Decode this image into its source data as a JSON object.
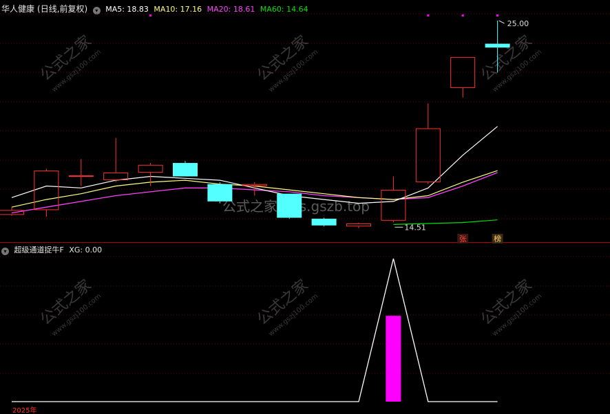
{
  "stock": {
    "name": "华人健康",
    "period": "(日线,前复权)",
    "ma5_label": "MA5: 18.83",
    "ma10_label": "MA10: 17.16",
    "ma20_label": "MA20: 18.61",
    "ma60_label": "MA60: 14.64"
  },
  "indicator": {
    "name": "超级通道捉牛F",
    "xg_label": "XG: 0.00"
  },
  "annotations": {
    "high": "25.00",
    "low": "14.51",
    "tag_zhang": "张",
    "tag_bang": "榜",
    "year": "2025年"
  },
  "watermark": {
    "logo_text": "公式之家",
    "url_small": "www.gszj100.com",
    "url_center": "公式之家 bbs.gszb.top"
  },
  "colors": {
    "background": "#000000",
    "up_candle": "#ff3232",
    "down_candle": "#54ffff",
    "ma5": "#ffffff",
    "ma10": "#ffff80",
    "ma20": "#ff40ff",
    "ma60": "#00e000",
    "signal": "#ff00ff"
  },
  "chart_data": {
    "type": "candlestick",
    "candles": [
      {
        "o": 14.9,
        "h": 15.3,
        "l": 14.85,
        "c": 15.15
      },
      {
        "o": 15.15,
        "h": 17.3,
        "l": 14.8,
        "c": 17.2
      },
      {
        "o": 16.9,
        "h": 17.8,
        "l": 16.4,
        "c": 16.95
      },
      {
        "o": 16.7,
        "h": 18.9,
        "l": 16.6,
        "c": 17.1
      },
      {
        "o": 17.1,
        "h": 17.6,
        "l": 16.4,
        "c": 17.5
      },
      {
        "o": 17.6,
        "h": 17.7,
        "l": 16.9,
        "c": 16.9
      },
      {
        "o": 16.5,
        "h": 16.6,
        "l": 15.5,
        "c": 15.6
      },
      {
        "o": 16.4,
        "h": 16.6,
        "l": 15.9,
        "c": 16.5
      },
      {
        "o": 16.0,
        "h": 16.0,
        "l": 14.7,
        "c": 14.75
      },
      {
        "o": 14.7,
        "h": 14.75,
        "l": 14.3,
        "c": 14.35
      },
      {
        "o": 14.3,
        "h": 14.5,
        "l": 14.2,
        "c": 14.45
      },
      {
        "o": 14.6,
        "h": 16.9,
        "l": 14.51,
        "c": 16.2
      },
      {
        "o": 16.6,
        "h": 20.7,
        "l": 16.5,
        "c": 19.4
      },
      {
        "o": 21.5,
        "h": 23.1,
        "l": 21.0,
        "c": 23.1
      },
      {
        "o": 23.8,
        "h": 25.0,
        "l": 22.3,
        "c": 23.6
      }
    ],
    "ma5": [
      15.8,
      16.4,
      16.3,
      16.7,
      16.9,
      16.8,
      16.7,
      16.3,
      15.9,
      15.7,
      15.5,
      15.6,
      16.3,
      18.0,
      19.5
    ],
    "ma10": [
      15.3,
      15.7,
      16.0,
      16.4,
      16.6,
      16.7,
      16.5,
      16.4,
      16.2,
      16.0,
      15.8,
      15.7,
      15.9,
      16.6,
      17.2
    ],
    "ma20": [
      15.0,
      15.3,
      15.6,
      15.9,
      16.1,
      16.3,
      16.3,
      16.2,
      16.1,
      15.9,
      15.8,
      15.7,
      15.8,
      16.4,
      17.1
    ],
    "ma60": [
      14.4,
      14.45,
      14.5,
      14.64
    ],
    "xg": [
      0,
      0,
      0,
      0,
      0,
      0,
      0,
      0,
      0,
      0,
      0,
      1,
      0,
      0,
      0
    ],
    "xg_peak": 1,
    "signal_bar_top": 0.6,
    "markers_top": [
      4,
      12,
      13,
      14
    ]
  }
}
